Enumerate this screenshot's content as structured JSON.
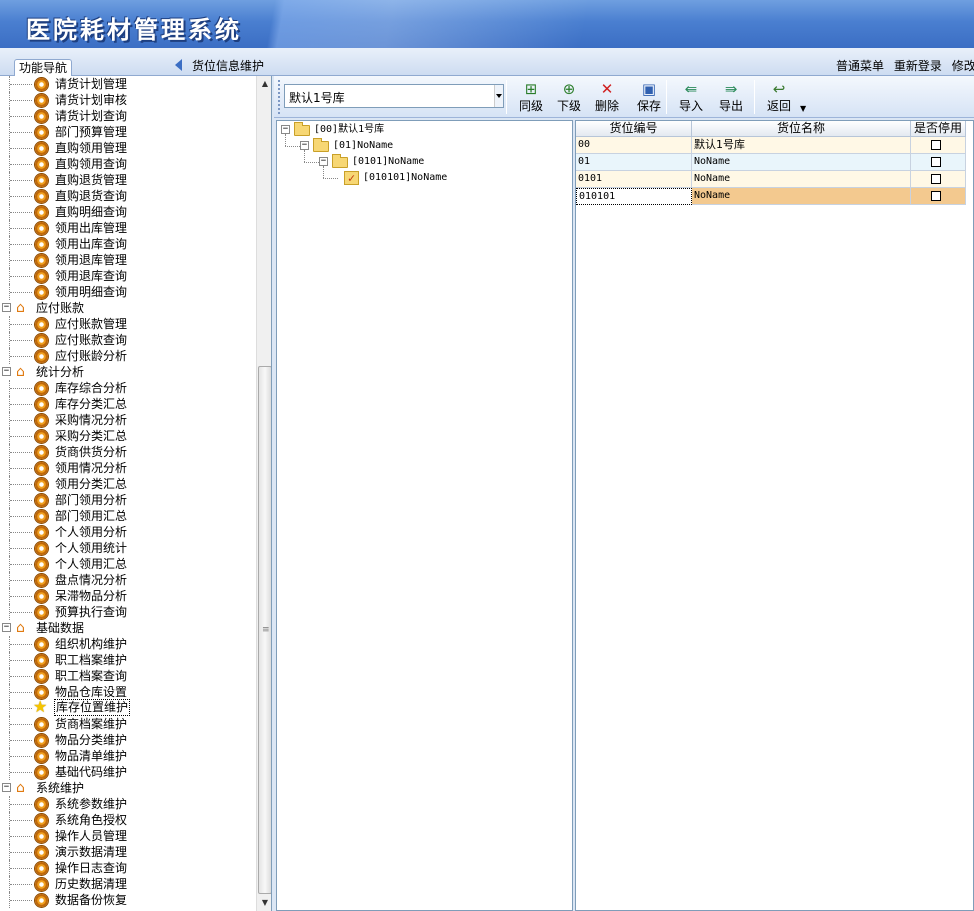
{
  "app": {
    "title": "医院耗材管理系统"
  },
  "tabs": {
    "nav_tab": "功能导航",
    "page_caption": "货位信息维护"
  },
  "top_links": [
    "普通菜单",
    "重新登录",
    "修改密"
  ],
  "nav": {
    "items": [
      {
        "type": "leaf",
        "label": "请货计划管理",
        "icon": "gear-icon"
      },
      {
        "type": "leaf",
        "label": "请货计划审核",
        "icon": "gear-icon"
      },
      {
        "type": "leaf",
        "label": "请货计划查询",
        "icon": "gear-icon"
      },
      {
        "type": "leaf",
        "label": "部门预算管理",
        "icon": "gear-icon"
      },
      {
        "type": "leaf",
        "label": "直购领用管理",
        "icon": "gear-icon"
      },
      {
        "type": "leaf",
        "label": "直购领用查询",
        "icon": "gear-icon"
      },
      {
        "type": "leaf",
        "label": "直购退货管理",
        "icon": "gear-icon"
      },
      {
        "type": "leaf",
        "label": "直购退货查询",
        "icon": "gear-icon"
      },
      {
        "type": "leaf",
        "label": "直购明细查询",
        "icon": "gear-icon"
      },
      {
        "type": "leaf",
        "label": "领用出库管理",
        "icon": "gear-icon"
      },
      {
        "type": "leaf",
        "label": "领用出库查询",
        "icon": "gear-icon"
      },
      {
        "type": "leaf",
        "label": "领用退库管理",
        "icon": "gear-icon"
      },
      {
        "type": "leaf",
        "label": "领用退库查询",
        "icon": "gear-icon"
      },
      {
        "type": "leaf",
        "label": "领用明细查询",
        "icon": "gear-icon"
      },
      {
        "type": "group",
        "label": "应付账款",
        "icon": "house-icon"
      },
      {
        "type": "leaf",
        "label": "应付账款管理",
        "icon": "gear-icon"
      },
      {
        "type": "leaf",
        "label": "应付账款查询",
        "icon": "gear-icon"
      },
      {
        "type": "leaf",
        "label": "应付账龄分析",
        "icon": "gear-icon"
      },
      {
        "type": "group",
        "label": "统计分析",
        "icon": "house-icon"
      },
      {
        "type": "leaf",
        "label": "库存综合分析",
        "icon": "gear-icon"
      },
      {
        "type": "leaf",
        "label": "库存分类汇总",
        "icon": "gear-icon"
      },
      {
        "type": "leaf",
        "label": "采购情况分析",
        "icon": "gear-icon"
      },
      {
        "type": "leaf",
        "label": "采购分类汇总",
        "icon": "gear-icon"
      },
      {
        "type": "leaf",
        "label": "货商供货分析",
        "icon": "gear-icon"
      },
      {
        "type": "leaf",
        "label": "领用情况分析",
        "icon": "gear-icon"
      },
      {
        "type": "leaf",
        "label": "领用分类汇总",
        "icon": "gear-icon"
      },
      {
        "type": "leaf",
        "label": "部门领用分析",
        "icon": "gear-icon"
      },
      {
        "type": "leaf",
        "label": "部门领用汇总",
        "icon": "gear-icon"
      },
      {
        "type": "leaf",
        "label": "个人领用分析",
        "icon": "gear-icon"
      },
      {
        "type": "leaf",
        "label": "个人领用统计",
        "icon": "gear-icon"
      },
      {
        "type": "leaf",
        "label": "个人领用汇总",
        "icon": "gear-icon"
      },
      {
        "type": "leaf",
        "label": "盘点情况分析",
        "icon": "gear-icon"
      },
      {
        "type": "leaf",
        "label": "呆滞物品分析",
        "icon": "gear-icon"
      },
      {
        "type": "leaf",
        "label": "预算执行查询",
        "icon": "gear-icon"
      },
      {
        "type": "group",
        "label": "基础数据",
        "icon": "house-icon"
      },
      {
        "type": "leaf",
        "label": "组织机构维护",
        "icon": "gear-icon"
      },
      {
        "type": "leaf",
        "label": "职工档案维护",
        "icon": "gear-icon"
      },
      {
        "type": "leaf",
        "label": "职工档案查询",
        "icon": "gear-icon"
      },
      {
        "type": "leaf",
        "label": "物品仓库设置",
        "icon": "gear-icon"
      },
      {
        "type": "leaf",
        "label": "库存位置维护",
        "icon": "star-icon",
        "selected": true
      },
      {
        "type": "leaf",
        "label": "货商档案维护",
        "icon": "gear-icon"
      },
      {
        "type": "leaf",
        "label": "物品分类维护",
        "icon": "gear-icon"
      },
      {
        "type": "leaf",
        "label": "物品清单维护",
        "icon": "gear-icon"
      },
      {
        "type": "leaf",
        "label": "基础代码维护",
        "icon": "gear-icon"
      },
      {
        "type": "group",
        "label": "系统维护",
        "icon": "house-icon"
      },
      {
        "type": "leaf",
        "label": "系统参数维护",
        "icon": "gear-icon"
      },
      {
        "type": "leaf",
        "label": "系统角色授权",
        "icon": "gear-icon"
      },
      {
        "type": "leaf",
        "label": "操作人员管理",
        "icon": "gear-icon"
      },
      {
        "type": "leaf",
        "label": "演示数据清理",
        "icon": "gear-icon"
      },
      {
        "type": "leaf",
        "label": "操作日志查询",
        "icon": "gear-icon"
      },
      {
        "type": "leaf",
        "label": "历史数据清理",
        "icon": "gear-icon"
      },
      {
        "type": "leaf",
        "label": "数据备份恢复",
        "icon": "gear-icon"
      }
    ]
  },
  "toolbar": {
    "warehouse_select": "默认1号库",
    "buttons": [
      {
        "label": "同级",
        "icon": "add-sibling-icon",
        "color": "#2a7d2a"
      },
      {
        "label": "下级",
        "icon": "add-child-icon",
        "color": "#2a7d2a"
      },
      {
        "label": "删除",
        "icon": "delete-icon",
        "color": "#d02020"
      },
      {
        "label": "保存",
        "icon": "save-icon",
        "color": "#3060b0"
      },
      {
        "label": "导入",
        "icon": "import-icon",
        "color": "#2a8a5a"
      },
      {
        "label": "导出",
        "icon": "export-icon",
        "color": "#2a8a5a"
      },
      {
        "label": "返回",
        "icon": "back-icon",
        "color": "#3a7a30"
      }
    ]
  },
  "tree": {
    "nodes": [
      {
        "text": "[00]默认1号库",
        "level": 0,
        "kind": "folder"
      },
      {
        "text": "[01]NoName",
        "level": 1,
        "kind": "folder"
      },
      {
        "text": "[0101]NoName",
        "level": 2,
        "kind": "folder"
      },
      {
        "text": "[010101]NoName",
        "level": 3,
        "kind": "checked"
      }
    ]
  },
  "grid": {
    "headers": [
      "货位编号",
      "货位名称",
      "是否停用"
    ],
    "rows": [
      {
        "code": "00",
        "name": "默认1号库",
        "disabled": false
      },
      {
        "code": "01",
        "name": "NoName",
        "disabled": false
      },
      {
        "code": "0101",
        "name": "NoName",
        "disabled": false
      },
      {
        "code": "010101",
        "name": "NoName",
        "disabled": false,
        "selected": true
      }
    ]
  }
}
